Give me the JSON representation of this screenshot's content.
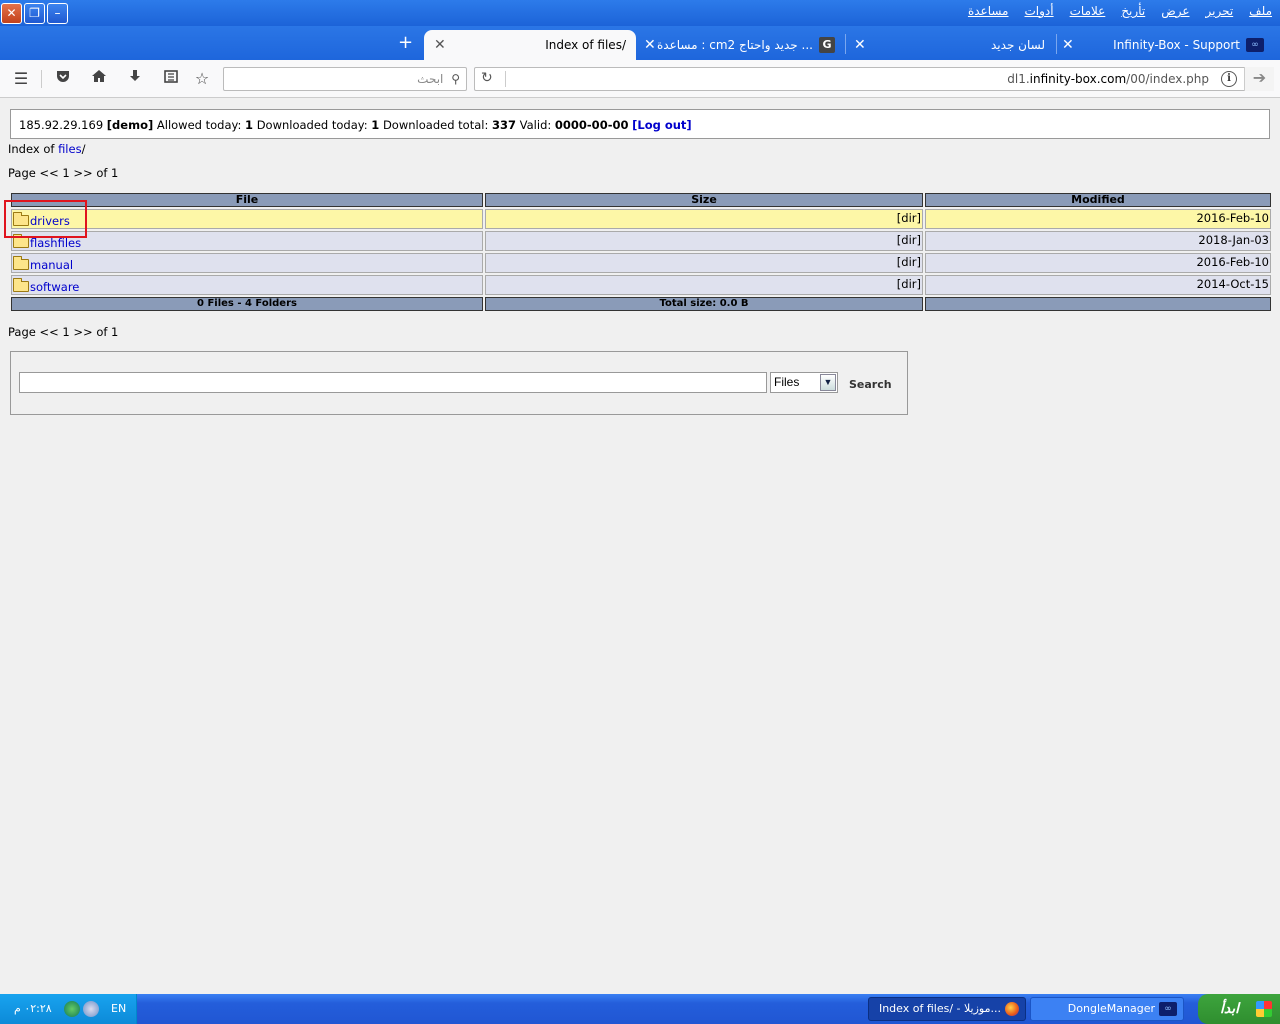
{
  "window": {
    "menu": [
      "ملف",
      "تحرير",
      "عرض",
      "تأريخ",
      "علامات",
      "أدوات",
      "مساعدة"
    ]
  },
  "tabs": [
    {
      "title": "Infinity-Box - Support",
      "active": false
    },
    {
      "title": "لسان جديد",
      "active": false
    },
    {
      "title": "مساعدة : cm2 جديد واحتاج ...",
      "active": false
    },
    {
      "title": "Index of files/",
      "active": true
    }
  ],
  "navbar": {
    "search_placeholder": "ابحث",
    "url_prefix": "dl1.",
    "url_domain": "infinity-box.com",
    "url_path": "/00/index.php"
  },
  "page": {
    "info": {
      "ip": "185.92.29.169",
      "account": "[demo]",
      "allowed_label": "Allowed today:",
      "allowed_value": "1",
      "downloaded_label": "Downloaded today:",
      "downloaded_value": "1",
      "total_label": "Downloaded total:",
      "total_value": "337",
      "valid_label": "Valid:",
      "valid_value": "0000-00-00",
      "logout": "[Log out]"
    },
    "index_prefix": "Index of",
    "index_link": "files",
    "index_suffix": "/",
    "pager": "Page << 1 >> of 1",
    "table": {
      "headers": [
        "File",
        "Size",
        "Modified"
      ],
      "rows": [
        {
          "name": "drivers",
          "size": "[dir]",
          "modified": "2016-Feb-10"
        },
        {
          "name": "flashfiles",
          "size": "[dir]",
          "modified": "2018-Jan-03"
        },
        {
          "name": "manual",
          "size": "[dir]",
          "modified": "2016-Feb-10"
        },
        {
          "name": "software",
          "size": "[dir]",
          "modified": "2014-Oct-15"
        }
      ],
      "footer_files": "0 Files - 4 Folders",
      "footer_size": "Total size: 0.0  B"
    },
    "search": {
      "input_value": "",
      "select_value": "Files",
      "button": "Search"
    }
  },
  "taskbar": {
    "clock": "٠٢:٢٨ م",
    "lang": "EN",
    "tasks": [
      "Index of files/ - موزيلا...",
      "DongleManager"
    ],
    "start": "ابدأ"
  },
  "colors": {
    "table_header": "#8a9bb8",
    "row_bg": "#dfe1ee",
    "row_highlight": "#fdf7a7",
    "link": "#0000cc",
    "highlight_box": "#e0141e"
  }
}
